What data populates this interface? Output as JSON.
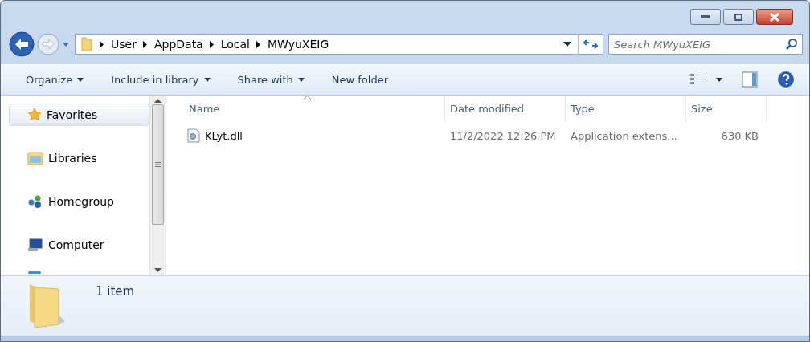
{
  "address_bar": {
    "crumbs": [
      "User",
      "AppData",
      "Local",
      "MWyuXEIG"
    ]
  },
  "search": {
    "placeholder": "Search MWyuXEIG"
  },
  "toolbar": {
    "buttons": [
      {
        "label": "Organize",
        "dropdown": true
      },
      {
        "label": "Include in library",
        "dropdown": true
      },
      {
        "label": "Share with",
        "dropdown": true
      },
      {
        "label": "New folder",
        "dropdown": false
      }
    ]
  },
  "sidebar": {
    "items": [
      {
        "label": "Favorites",
        "kind": "favorites",
        "selected": true
      },
      {
        "label": "Libraries",
        "kind": "libraries",
        "selected": false
      },
      {
        "label": "Homegroup",
        "kind": "homegroup",
        "selected": false
      },
      {
        "label": "Computer",
        "kind": "computer",
        "selected": false
      }
    ]
  },
  "table": {
    "columns": [
      {
        "label": "Name",
        "sorted": true
      },
      {
        "label": "Date modified",
        "sorted": false
      },
      {
        "label": "Type",
        "sorted": false
      },
      {
        "label": "Size",
        "sorted": false
      }
    ],
    "rows": [
      {
        "name": "KLyt.dll",
        "date": "11/2/2022 12:26 PM",
        "type": "Application extens...",
        "size": "630 KB"
      }
    ]
  },
  "details_pane": {
    "count": "1 item"
  }
}
